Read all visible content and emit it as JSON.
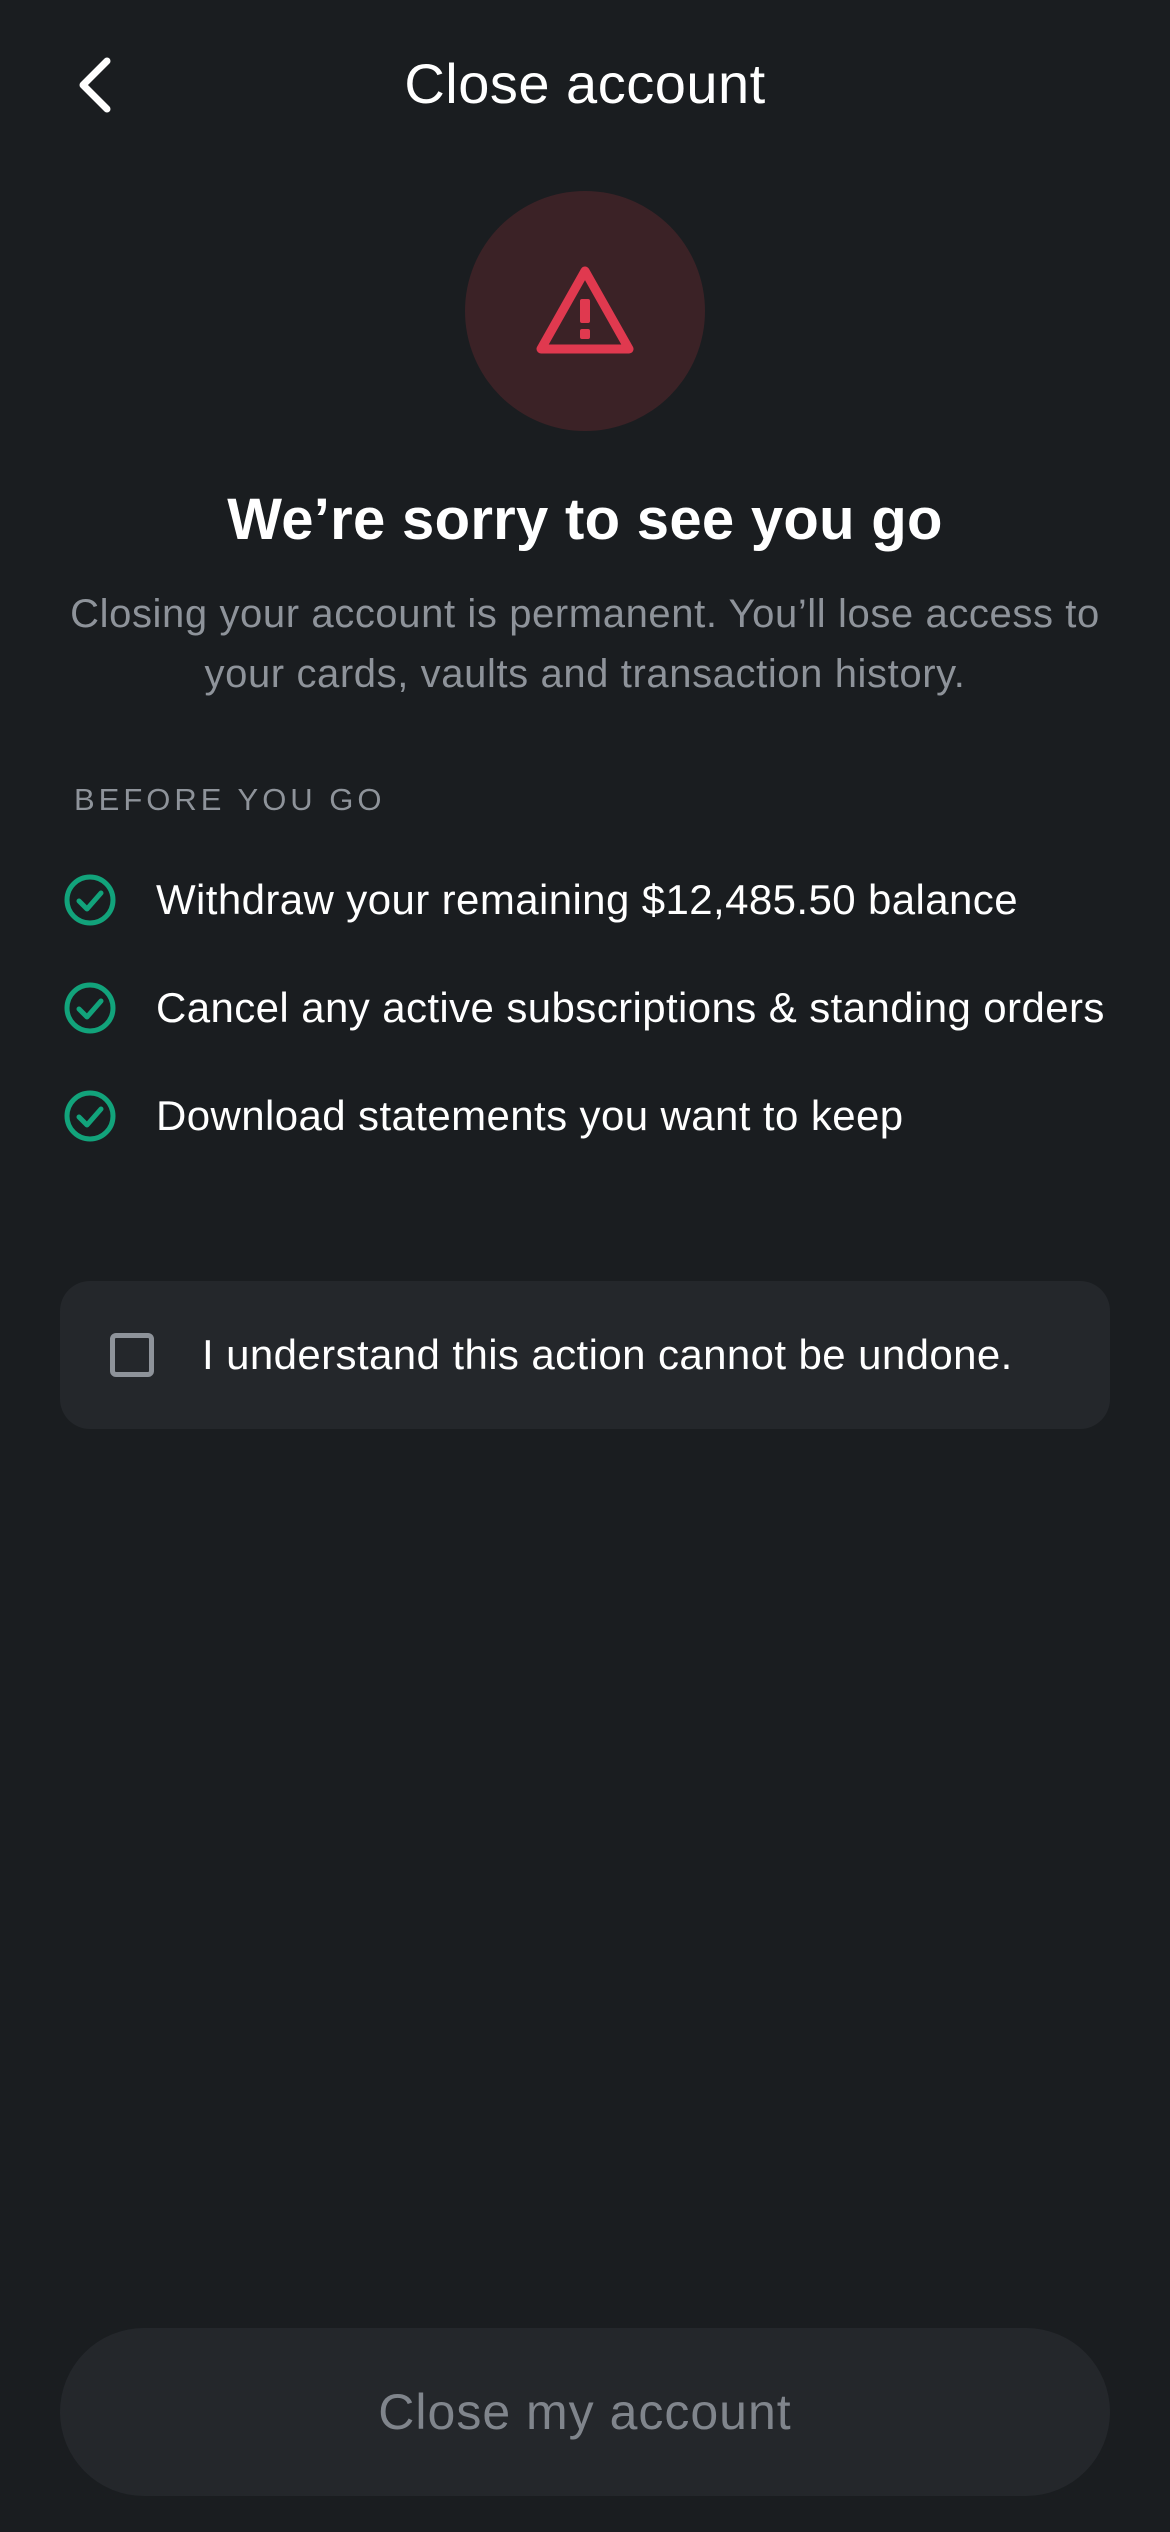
{
  "header": {
    "title": "Close account",
    "back_icon": "chevron-left-icon"
  },
  "hero": {
    "icon": "warning-triangle-icon",
    "icon_color": "#e0394f",
    "icon_bg": "#3b2226",
    "headline": "We’re sorry to see you go",
    "description": "Closing your account is permanent. You’ll lose access to your cards, vaults and transaction history."
  },
  "checklist": {
    "section_label": "BEFORE YOU GO",
    "check_icon": "check-circle-icon",
    "check_color": "#12a37b",
    "items": [
      {
        "text": "Withdraw your remaining $12,485.50 balance"
      },
      {
        "text": "Cancel any active subscriptions & standing orders"
      },
      {
        "text": "Download statements you want to keep"
      }
    ]
  },
  "confirmation": {
    "checked": false,
    "label": "I understand this action cannot be undone."
  },
  "actions": {
    "primary_label": "Close my account",
    "primary_enabled": false
  }
}
